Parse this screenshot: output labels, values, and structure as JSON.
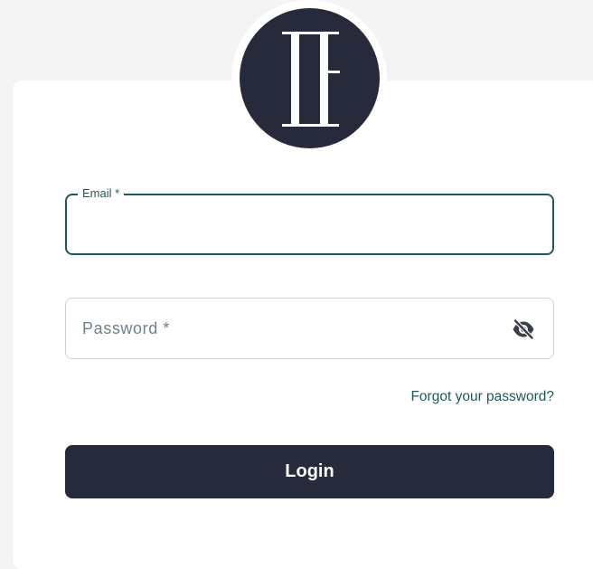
{
  "logo": {
    "icon": "monogram-logo",
    "colors": {
      "background": "#272a3a",
      "mark": "#ffffff"
    }
  },
  "email": {
    "label": "Email *",
    "value": ""
  },
  "password": {
    "placeholder": "Password *",
    "value": "",
    "toggle_icon": "eye-slash-icon"
  },
  "forgot_password": {
    "label": "Forgot your password?"
  },
  "login_button": {
    "label": "Login"
  },
  "colors": {
    "accent": "#1e5a5c",
    "button": "#272a3a",
    "page_bg": "#f4f4f4"
  }
}
